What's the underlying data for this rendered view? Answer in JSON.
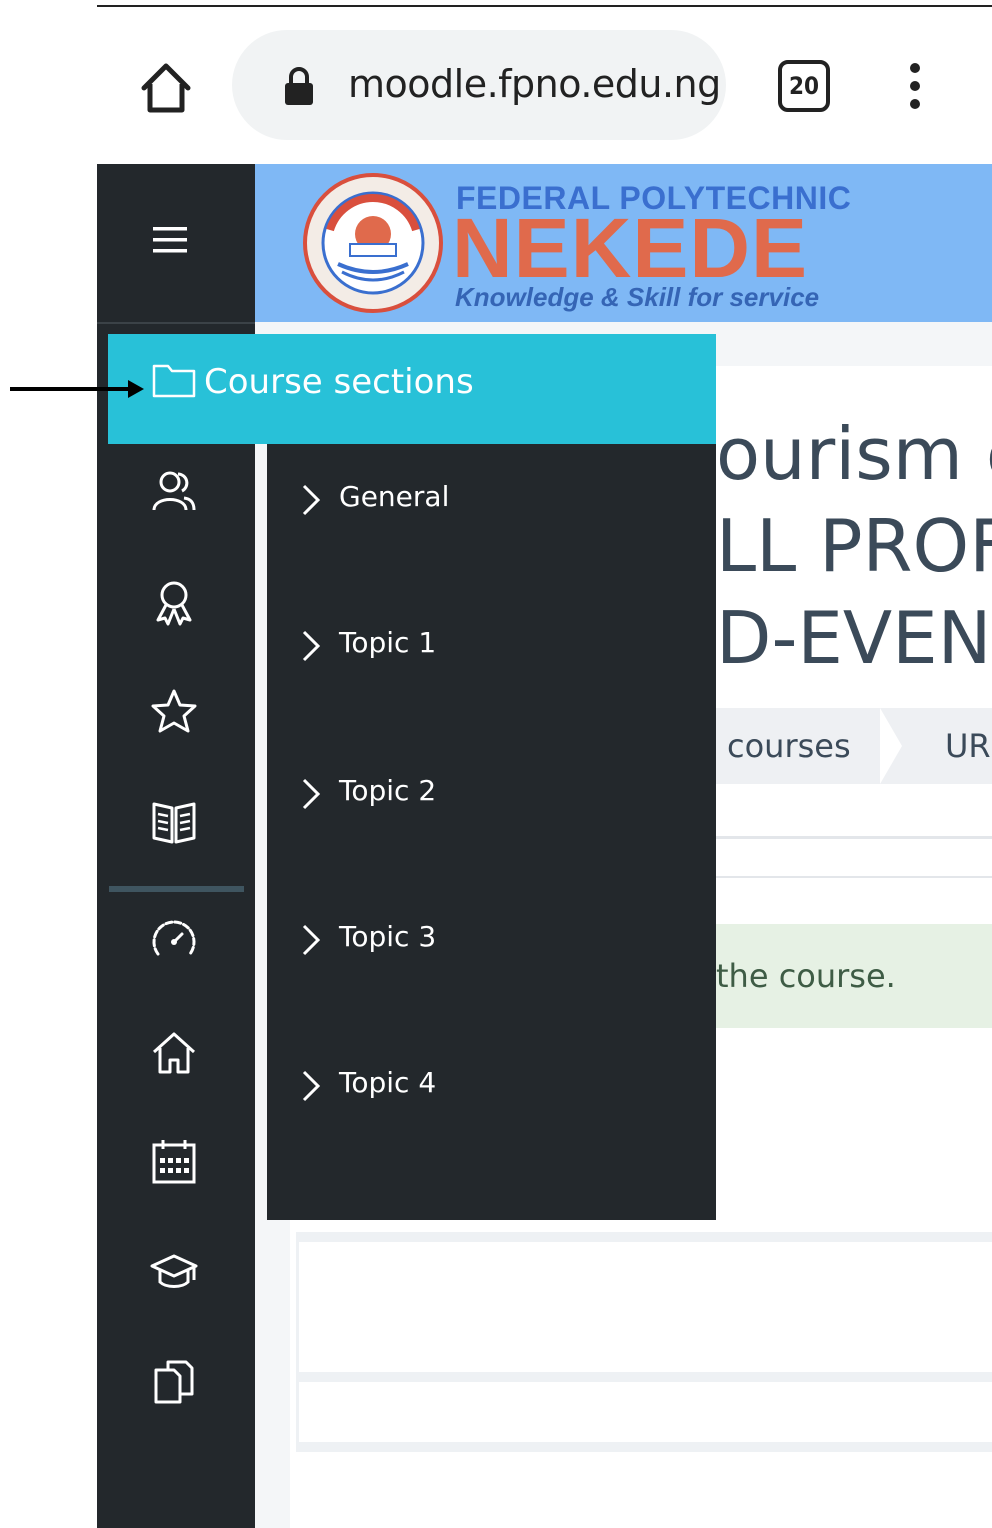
{
  "browser": {
    "url": "moodle.fpno.edu.ng",
    "tab_count": "20"
  },
  "logo": {
    "line1": "FEDERAL POLYTECHNIC",
    "line2": "NEKEDE",
    "line3": "Knowledge & Skill for service"
  },
  "course_title": {
    "line1": "ourism c",
    "line2": "LL PROF",
    "line3": "D-EVEN"
  },
  "breadcrumb": {
    "item1": "courses",
    "item2": "URI"
  },
  "notice": {
    "text": "the course."
  },
  "course_index": {
    "title": "Course sections",
    "items": [
      {
        "label": "General"
      },
      {
        "label": "Topic 1"
      },
      {
        "label": "Topic 2"
      },
      {
        "label": "Topic 3"
      },
      {
        "label": "Topic 4"
      }
    ]
  },
  "sidebar": {
    "icons": [
      "participants-icon",
      "badges-icon",
      "competencies-icon",
      "grades-icon",
      "dashboard-icon",
      "site-home-icon",
      "calendar-icon",
      "my-courses-icon",
      "content-bank-icon"
    ]
  },
  "colors": {
    "sidebar_bg": "#23282c",
    "header_band": "#7fb8f5",
    "course_index_header": "#28c1d8",
    "logo_red": "#e06a4c",
    "logo_blue": "#3a6fcf"
  }
}
